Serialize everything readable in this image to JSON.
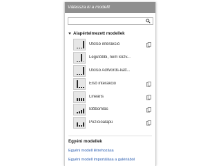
{
  "panel": {
    "title": "Válassza ki a modellt",
    "search": {
      "value": "",
      "placeholder": ""
    },
    "default_section": "Alapértelmezett modellek",
    "models": [
      {
        "label": "Utolsó interakció",
        "icon": "last-interaction-chart-icon"
      },
      {
        "label": "Legutóbbi, nem közv...",
        "icon": "last-indirect-chart-icon"
      },
      {
        "label": "Utolsó AdWords-katt...",
        "icon": "last-adwords-chart-icon"
      },
      {
        "label": "Első interakció",
        "icon": "first-interaction-chart-icon"
      },
      {
        "label": "Lineáris",
        "icon": "linear-chart-icon"
      },
      {
        "label": "Időbomlás",
        "icon": "time-decay-chart-icon"
      },
      {
        "label": "Pozícióalapú",
        "icon": "position-based-chart-icon"
      }
    ],
    "custom_section": "Egyéni modellek",
    "create_link": "Egyéni modell létrehozása",
    "import_link": "Egyéni modell importálása a galériából"
  },
  "colors": {
    "header_bg": "#8f8f8f",
    "link": "#2a5db0"
  }
}
